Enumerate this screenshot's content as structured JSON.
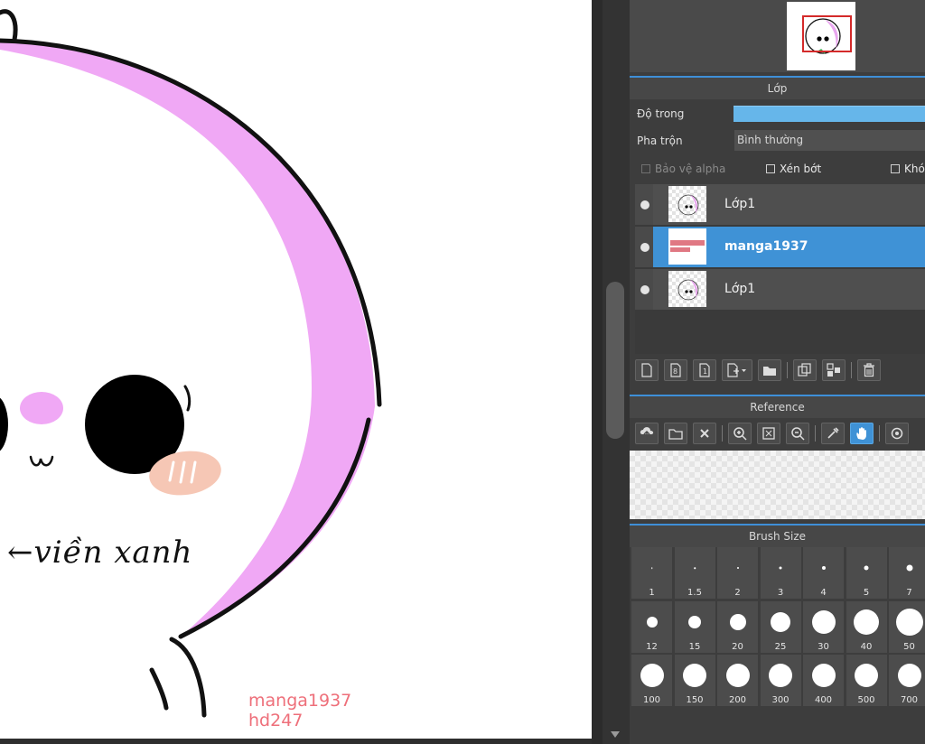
{
  "canvas": {
    "handwritten_note": "←viền xanh",
    "watermark_lines": [
      "manga1937",
      "hd247"
    ]
  },
  "layer_panel": {
    "title": "Lớp",
    "opacity_label": "Độ trong",
    "opacity_value": 1.0,
    "blend_label": "Pha trộn",
    "blend_value": "Bình thường",
    "checks": [
      {
        "label": "Bảo vệ alpha",
        "enabled": false
      },
      {
        "label": "Xén bớt",
        "enabled": true
      },
      {
        "label": "Khó",
        "enabled": true
      }
    ],
    "layers": [
      {
        "name": "Lớp1",
        "selected": false,
        "thumb": "face"
      },
      {
        "name": "manga1937",
        "selected": true,
        "thumb": "watermark"
      },
      {
        "name": "Lớp1",
        "selected": false,
        "thumb": "face"
      }
    ],
    "toolbar_icons": [
      "new-layer-icon",
      "new-8bit-layer-icon",
      "new-1bit-layer-icon",
      "add-layer-menu-icon",
      "folder-icon",
      "duplicate-layer-icon",
      "merge-layer-icon",
      "delete-layer-icon"
    ]
  },
  "reference_panel": {
    "title": "Reference",
    "toolbar_icons": [
      "upload-icon",
      "open-folder-icon",
      "close-icon",
      "zoom-in-icon",
      "fit-icon",
      "zoom-out-icon",
      "eyedropper-icon",
      "hand-icon",
      "rotate-icon"
    ]
  },
  "brush_panel": {
    "title": "Brush Size",
    "sizes": [
      "1",
      "1.5",
      "2",
      "3",
      "4",
      "5",
      "7",
      "12",
      "15",
      "20",
      "25",
      "30",
      "40",
      "50",
      "100",
      "150",
      "200",
      "300",
      "400",
      "500",
      "700"
    ]
  },
  "colors": {
    "accent": "#3f92d6",
    "opacity_fill": "#66b6ea",
    "pink": "#f0a8f5",
    "blush": "#f6c7b5",
    "watermark": "#ee6f7a"
  }
}
